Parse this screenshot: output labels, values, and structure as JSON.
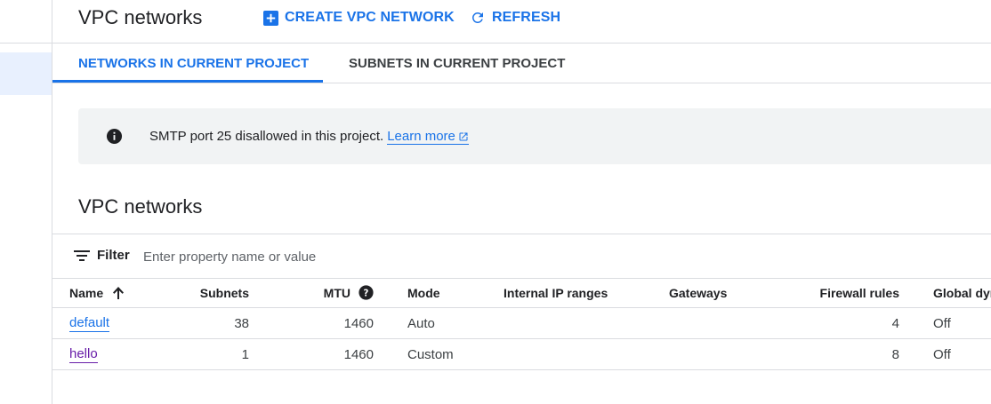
{
  "header": {
    "title": "VPC networks",
    "create_label": "CREATE VPC NETWORK",
    "refresh_label": "REFRESH"
  },
  "tabs": [
    {
      "label": "NETWORKS IN CURRENT PROJECT",
      "active": true
    },
    {
      "label": "SUBNETS IN CURRENT PROJECT",
      "active": false
    }
  ],
  "banner": {
    "message": "SMTP port 25 disallowed in this project.",
    "link_label": "Learn more"
  },
  "section": {
    "title": "VPC networks"
  },
  "filter": {
    "label": "Filter",
    "placeholder": "Enter property name or value"
  },
  "table": {
    "columns": [
      "Name",
      "Subnets",
      "MTU",
      "Mode",
      "Internal IP ranges",
      "Gateways",
      "Firewall rules",
      "Global dyn"
    ],
    "rows": [
      {
        "name": "default",
        "subnets": "38",
        "mtu": "1460",
        "mode": "Auto",
        "ip_ranges": "",
        "gateways": "",
        "firewall_rules": "4",
        "global_dynamic": "Off"
      },
      {
        "name": "hello",
        "subnets": "1",
        "mtu": "1460",
        "mode": "Custom",
        "ip_ranges": "",
        "gateways": "",
        "firewall_rules": "8",
        "global_dynamic": "Off"
      }
    ]
  },
  "colors": {
    "accent": "#1a73e8",
    "visited_link": "#681da8",
    "banner_bg": "#f1f3f4",
    "selected_nav_bg": "#e8f0fe"
  },
  "icons": {
    "create": "add-box-icon",
    "refresh": "refresh-icon",
    "info": "info-icon",
    "external": "open-in-new-icon",
    "filter": "filter-list-icon",
    "sort": "arrow-upward-icon",
    "help": "help-circle-icon"
  }
}
